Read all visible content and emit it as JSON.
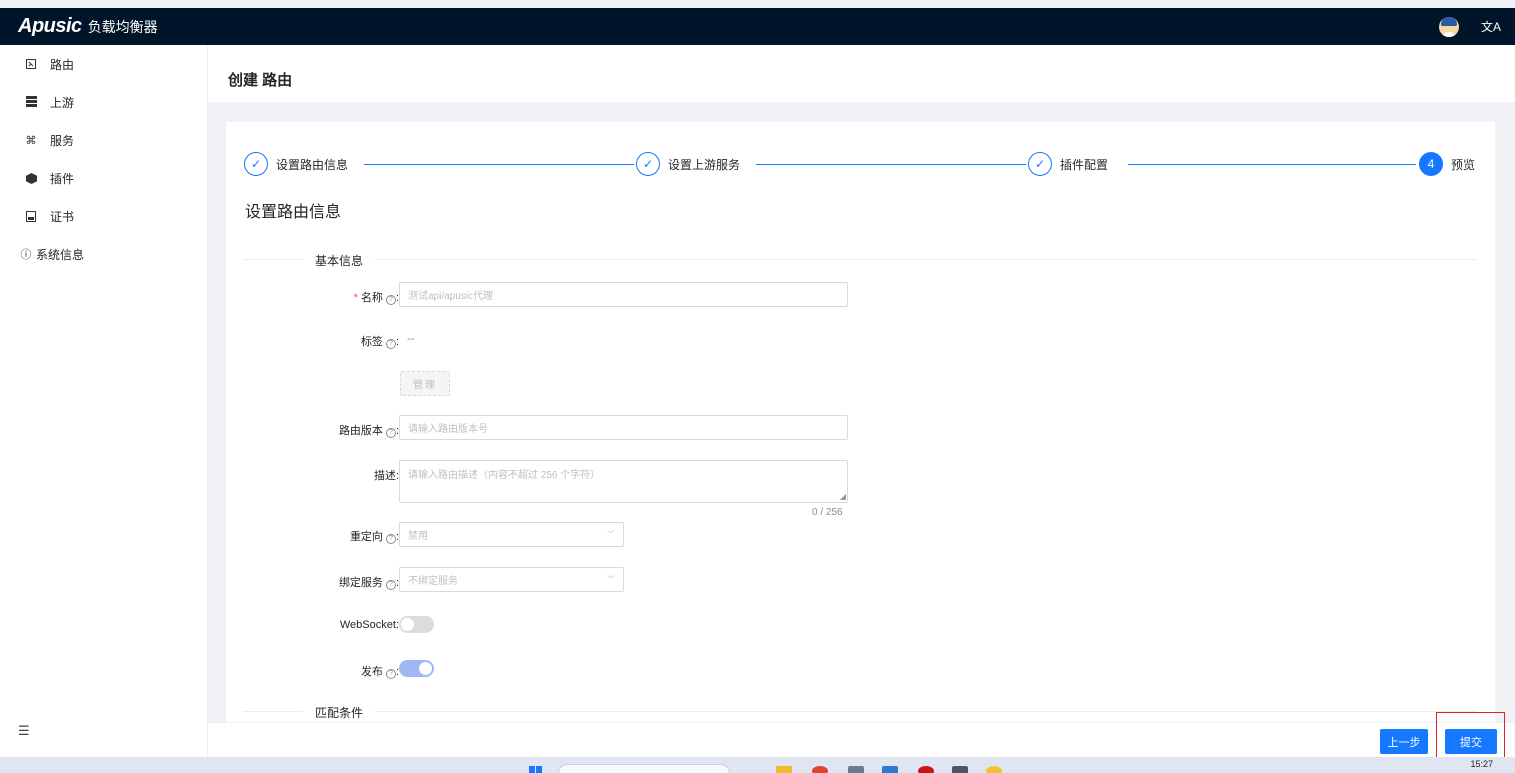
{
  "app": {
    "logo": "Apusic",
    "title": "负载均衡器"
  },
  "sidebar": {
    "items": [
      {
        "label": "路由",
        "icon": "route-icon"
      },
      {
        "label": "上游",
        "icon": "server-icon"
      },
      {
        "label": "服务",
        "icon": "service-icon"
      },
      {
        "label": "插件",
        "icon": "plugin-icon"
      },
      {
        "label": "证书",
        "icon": "certificate-icon"
      },
      {
        "label": "系统信息",
        "icon": "info-icon"
      }
    ]
  },
  "page": {
    "title": "创建 路由"
  },
  "steps": [
    {
      "label": "设置路由信息",
      "status": "done"
    },
    {
      "label": "设置上游服务",
      "status": "done"
    },
    {
      "label": "插件配置",
      "status": "done"
    },
    {
      "label": "预览",
      "status": "current",
      "number": "4"
    }
  ],
  "section_title": "设置路由信息",
  "form": {
    "basic_divider": "基本信息",
    "name": {
      "label": "名称",
      "placeholder": "测试api/apusic代理"
    },
    "labels": {
      "label": "标签",
      "value": "--",
      "manage_button": "管理"
    },
    "version": {
      "label": "路由版本",
      "placeholder": "请输入路由版本号"
    },
    "description": {
      "label": "描述",
      "placeholder": "请输入路由描述（内容不超过 256 个字符）",
      "counter": "0 / 256"
    },
    "redirect": {
      "label": "重定向",
      "value": "禁用"
    },
    "bind_service": {
      "label": "绑定服务",
      "value": "不绑定服务"
    },
    "websocket": {
      "label": "WebSocket",
      "enabled": false
    },
    "publish": {
      "label": "发布",
      "enabled": true
    },
    "match_divider": "匹配条件"
  },
  "footer": {
    "prev_button": "上一步",
    "submit_button": "提交"
  },
  "taskbar": {
    "time": "15:27"
  },
  "colors": {
    "primary": "#1677ff",
    "header_bg": "#001529",
    "highlight": "#e02424"
  }
}
